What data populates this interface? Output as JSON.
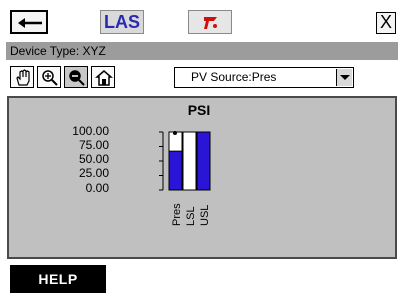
{
  "toolbar": {
    "las_label": "LAS",
    "close_label": "X"
  },
  "device": {
    "type_text": "Device Type: XYZ"
  },
  "tools": {
    "source_value": "PV Source:Pres"
  },
  "chart_data": {
    "type": "bar",
    "title": "PSI",
    "categories": [
      "Pres",
      "LSL",
      "USL"
    ],
    "values": [
      67,
      0,
      100
    ],
    "ylim": [
      0,
      100
    ],
    "yticks": [
      "100.00",
      "75.00",
      "50.00",
      "25.00",
      "0.00"
    ],
    "colors": [
      "#2a14d6",
      "#2a14d6",
      "#2a14d6"
    ],
    "grid": false
  },
  "footer": {
    "help_label": "HELP"
  }
}
